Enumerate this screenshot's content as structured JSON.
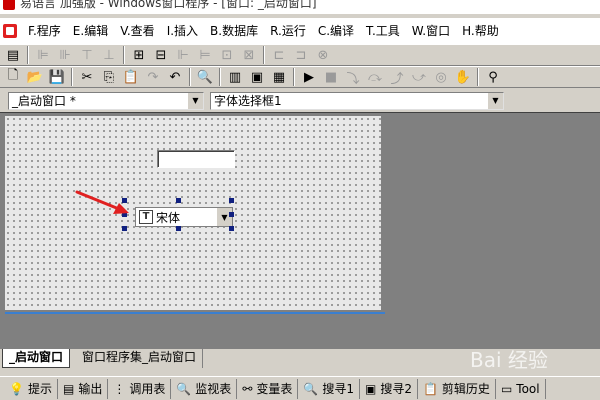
{
  "window": {
    "title": "易语言 加强版 - Windows窗口程序 - [窗口: _启动窗口]"
  },
  "menu": {
    "items": [
      "F.程序",
      "E.编辑",
      "V.查看",
      "I.插入",
      "B.数据库",
      "R.运行",
      "C.编译",
      "T.工具",
      "W.窗口",
      "H.帮助"
    ]
  },
  "selectors": {
    "window_value": "_启动窗口 *",
    "component_value": "字体选择框1"
  },
  "design": {
    "font_combo_value": "宋体"
  },
  "tabs": [
    "_启动窗口",
    "窗口程序集_启动窗口"
  ],
  "bottom_panels": [
    {
      "icon": "hint-icon",
      "label": "提示"
    },
    {
      "icon": "output-icon",
      "label": "输出"
    },
    {
      "icon": "call-table-icon",
      "label": "调用表"
    },
    {
      "icon": "watch-icon",
      "label": "监视表"
    },
    {
      "icon": "variable-icon",
      "label": "变量表"
    },
    {
      "icon": "search-icon",
      "label": "搜寻1"
    },
    {
      "icon": "search2-icon",
      "label": "搜寻2"
    },
    {
      "icon": "clipboard-icon",
      "label": "剪辑历史"
    },
    {
      "icon": "toolbox-icon",
      "label": "Tool"
    }
  ],
  "watermark": "Bai 经验"
}
